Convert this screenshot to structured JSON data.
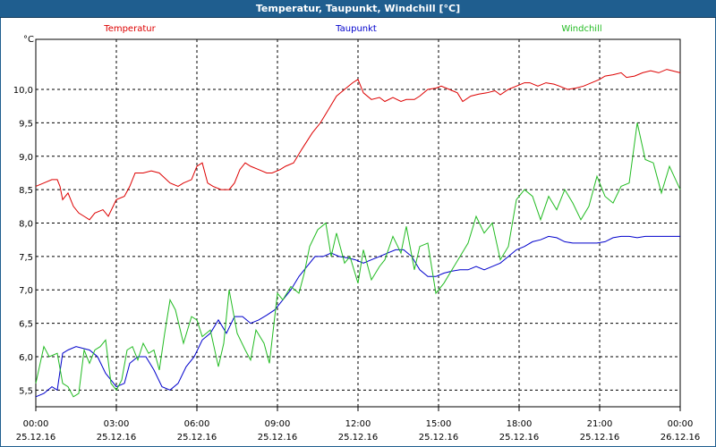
{
  "window": {
    "title": "Temperatur, Taupunkt, Windchill [°C]"
  },
  "chart_data": {
    "type": "line",
    "title": "Temperatur, Taupunkt, Windchill [°C]",
    "ylabel": "°C",
    "ylim": [
      5.25,
      10.75
    ],
    "xlim": [
      0,
      24
    ],
    "grid": true,
    "y_ticks": [
      "5,5",
      "6,0",
      "6,5",
      "7,0",
      "7,5",
      "8,0",
      "8,5",
      "9,0",
      "9,5",
      "10,0"
    ],
    "y_tick_values": [
      5.5,
      6.0,
      6.5,
      7.0,
      7.5,
      8.0,
      8.5,
      9.0,
      9.5,
      10.0
    ],
    "x_ticks": [
      {
        "time": "00:00",
        "date": "25.12.16",
        "h": 0
      },
      {
        "time": "03:00",
        "date": "25.12.16",
        "h": 3
      },
      {
        "time": "06:00",
        "date": "25.12.16",
        "h": 6
      },
      {
        "time": "09:00",
        "date": "25.12.16",
        "h": 9
      },
      {
        "time": "12:00",
        "date": "25.12.16",
        "h": 12
      },
      {
        "time": "15:00",
        "date": "25.12.16",
        "h": 15
      },
      {
        "time": "18:00",
        "date": "25.12.16",
        "h": 18
      },
      {
        "time": "21:00",
        "date": "25.12.16",
        "h": 21
      },
      {
        "time": "00:00",
        "date": "26.12.16",
        "h": 24
      }
    ],
    "series": [
      {
        "name": "Temperatur",
        "color": "#dd0000",
        "x": [
          0,
          0.3,
          0.6,
          0.8,
          0.9,
          1.0,
          1.2,
          1.4,
          1.6,
          1.8,
          2.0,
          2.2,
          2.5,
          2.7,
          3.0,
          3.3,
          3.5,
          3.7,
          4.0,
          4.3,
          4.6,
          5.0,
          5.3,
          5.5,
          5.8,
          6.0,
          6.2,
          6.4,
          6.6,
          6.9,
          7.2,
          7.4,
          7.6,
          7.8,
          8.0,
          8.3,
          8.6,
          8.8,
          9.1,
          9.3,
          9.6,
          9.9,
          10.3,
          10.6,
          10.9,
          11.2,
          11.5,
          11.8,
          12.0,
          12.2,
          12.5,
          12.8,
          13.0,
          13.3,
          13.6,
          13.8,
          14.1,
          14.3,
          14.6,
          14.9,
          15.1,
          15.4,
          15.7,
          15.9,
          16.2,
          16.5,
          16.8,
          17.1,
          17.3,
          17.6,
          17.9,
          18.2,
          18.4,
          18.7,
          19.0,
          19.3,
          19.5,
          19.8,
          20.1,
          20.4,
          20.7,
          21.0,
          21.2,
          21.5,
          21.8,
          22.0,
          22.3,
          22.6,
          22.9,
          23.2,
          23.5,
          23.7,
          24.0
        ],
        "values": [
          8.55,
          8.6,
          8.65,
          8.65,
          8.55,
          8.35,
          8.45,
          8.25,
          8.15,
          8.1,
          8.05,
          8.15,
          8.2,
          8.1,
          8.35,
          8.4,
          8.55,
          8.75,
          8.75,
          8.78,
          8.75,
          8.6,
          8.55,
          8.6,
          8.65,
          8.85,
          8.9,
          8.6,
          8.55,
          8.5,
          8.5,
          8.6,
          8.8,
          8.9,
          8.85,
          8.8,
          8.75,
          8.75,
          8.8,
          8.85,
          8.9,
          9.1,
          9.35,
          9.5,
          9.7,
          9.9,
          10.0,
          10.1,
          10.15,
          9.95,
          9.85,
          9.88,
          9.82,
          9.88,
          9.82,
          9.85,
          9.85,
          9.9,
          10.0,
          10.02,
          10.05,
          10.0,
          9.95,
          9.82,
          9.9,
          9.93,
          9.95,
          9.98,
          9.92,
          10.0,
          10.05,
          10.1,
          10.1,
          10.05,
          10.1,
          10.08,
          10.05,
          10.0,
          10.02,
          10.05,
          10.1,
          10.15,
          10.2,
          10.22,
          10.25,
          10.18,
          10.2,
          10.25,
          10.28,
          10.25,
          10.3,
          10.28,
          10.25
        ]
      },
      {
        "name": "Taupunkt",
        "color": "#0000cc",
        "x": [
          0,
          0.3,
          0.6,
          0.8,
          1.0,
          1.2,
          1.5,
          1.8,
          2.0,
          2.3,
          2.6,
          2.8,
          3.0,
          3.3,
          3.5,
          3.8,
          4.1,
          4.4,
          4.7,
          5.0,
          5.3,
          5.6,
          5.9,
          6.2,
          6.5,
          6.8,
          7.1,
          7.4,
          7.7,
          8.0,
          8.3,
          8.6,
          8.9,
          9.2,
          9.5,
          9.8,
          10.1,
          10.4,
          10.7,
          11.0,
          11.3,
          11.6,
          11.9,
          12.2,
          12.5,
          12.8,
          13.1,
          13.4,
          13.7,
          14.0,
          14.3,
          14.6,
          14.9,
          15.2,
          15.5,
          15.8,
          16.1,
          16.4,
          16.7,
          17.0,
          17.3,
          17.6,
          17.9,
          18.2,
          18.5,
          18.8,
          19.1,
          19.4,
          19.7,
          20.0,
          20.3,
          20.6,
          20.9,
          21.2,
          21.5,
          21.8,
          22.1,
          22.4,
          22.7,
          23.0,
          23.3,
          23.6,
          23.8,
          24.0
        ],
        "values": [
          5.4,
          5.45,
          5.55,
          5.5,
          6.05,
          6.1,
          6.15,
          6.12,
          6.1,
          6.0,
          5.75,
          5.65,
          5.55,
          5.6,
          5.9,
          6.0,
          6.0,
          5.8,
          5.55,
          5.5,
          5.6,
          5.85,
          6.0,
          6.25,
          6.35,
          6.55,
          6.35,
          6.6,
          6.6,
          6.5,
          6.55,
          6.62,
          6.7,
          6.85,
          7.0,
          7.2,
          7.35,
          7.5,
          7.5,
          7.55,
          7.5,
          7.48,
          7.45,
          7.4,
          7.45,
          7.5,
          7.55,
          7.6,
          7.6,
          7.5,
          7.3,
          7.2,
          7.2,
          7.25,
          7.28,
          7.3,
          7.3,
          7.35,
          7.3,
          7.35,
          7.4,
          7.5,
          7.6,
          7.65,
          7.72,
          7.75,
          7.8,
          7.78,
          7.72,
          7.7,
          7.7,
          7.7,
          7.7,
          7.72,
          7.78,
          7.8,
          7.8,
          7.78,
          7.8,
          7.8,
          7.8,
          7.8,
          7.8,
          7.8
        ]
      },
      {
        "name": "Windchill",
        "color": "#22bb22",
        "x": [
          0,
          0.3,
          0.5,
          0.8,
          1.0,
          1.2,
          1.4,
          1.6,
          1.8,
          2.0,
          2.2,
          2.4,
          2.6,
          2.8,
          3.0,
          3.2,
          3.4,
          3.6,
          3.8,
          4.0,
          4.2,
          4.4,
          4.6,
          4.8,
          5.0,
          5.2,
          5.5,
          5.8,
          6.0,
          6.2,
          6.5,
          6.8,
          7.0,
          7.2,
          7.5,
          7.8,
          8.0,
          8.2,
          8.5,
          8.7,
          9.0,
          9.2,
          9.5,
          9.8,
          10.0,
          10.2,
          10.5,
          10.8,
          11.0,
          11.2,
          11.5,
          11.7,
          12.0,
          12.2,
          12.5,
          12.8,
          13.0,
          13.3,
          13.6,
          13.8,
          14.1,
          14.3,
          14.6,
          14.9,
          15.2,
          15.5,
          15.8,
          16.1,
          16.4,
          16.7,
          17.0,
          17.3,
          17.6,
          17.9,
          18.2,
          18.5,
          18.8,
          19.1,
          19.4,
          19.7,
          20.0,
          20.3,
          20.6,
          20.9,
          21.2,
          21.5,
          21.8,
          22.1,
          22.4,
          22.7,
          23.0,
          23.3,
          23.6,
          24.0
        ],
        "values": [
          5.6,
          6.15,
          6.0,
          6.05,
          5.6,
          5.55,
          5.4,
          5.45,
          6.1,
          5.9,
          6.1,
          6.15,
          6.25,
          5.6,
          5.5,
          5.65,
          6.1,
          6.15,
          5.95,
          6.2,
          6.05,
          6.1,
          5.8,
          6.35,
          6.85,
          6.7,
          6.2,
          6.6,
          6.55,
          6.3,
          6.4,
          5.85,
          6.2,
          7.0,
          6.35,
          6.1,
          5.95,
          6.4,
          6.2,
          5.9,
          6.95,
          6.85,
          7.05,
          6.95,
          7.25,
          7.65,
          7.9,
          8.0,
          7.5,
          7.85,
          7.4,
          7.5,
          7.1,
          7.6,
          7.15,
          7.35,
          7.45,
          7.8,
          7.55,
          7.95,
          7.3,
          7.65,
          7.7,
          6.95,
          7.1,
          7.3,
          7.5,
          7.7,
          8.1,
          7.85,
          8.0,
          7.45,
          7.65,
          8.35,
          8.5,
          8.4,
          8.05,
          8.4,
          8.2,
          8.5,
          8.3,
          8.05,
          8.25,
          8.7,
          8.4,
          8.3,
          8.55,
          8.6,
          9.5,
          8.95,
          8.9,
          8.45,
          8.85,
          8.5
        ]
      }
    ]
  }
}
